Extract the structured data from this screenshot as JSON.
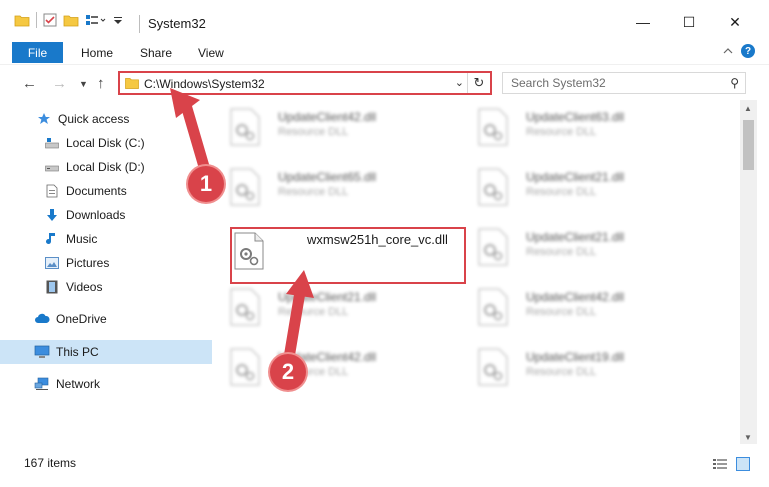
{
  "window": {
    "title": "System32",
    "controls": {
      "minimize": "—",
      "maximize": "☐",
      "close": "✕"
    }
  },
  "ribbon": {
    "file_tab": "File",
    "tabs": [
      "Home",
      "Share",
      "View"
    ],
    "help": "?"
  },
  "address": {
    "path": "C:\\Windows\\System32",
    "search_placeholder": "Search System32"
  },
  "sidebar": {
    "items": [
      {
        "label": "Quick access",
        "icon": "star-icon"
      },
      {
        "label": "Local Disk (C:)",
        "icon": "drive-icon"
      },
      {
        "label": "Local Disk (D:)",
        "icon": "drive-icon"
      },
      {
        "label": "Documents",
        "icon": "documents-icon"
      },
      {
        "label": "Downloads",
        "icon": "download-icon"
      },
      {
        "label": "Music",
        "icon": "music-icon"
      },
      {
        "label": "Pictures",
        "icon": "pictures-icon"
      },
      {
        "label": "Videos",
        "icon": "video-icon"
      },
      {
        "label": "OneDrive",
        "icon": "cloud-icon"
      },
      {
        "label": "This PC",
        "icon": "computer-icon"
      },
      {
        "label": "Network",
        "icon": "network-icon"
      }
    ]
  },
  "files": [
    {
      "name": "UpdateClient42.dll",
      "type": "Resource DLL"
    },
    {
      "name": "UpdateClient63.dll",
      "type": "Resource DLL"
    },
    {
      "name": "UpdateClient65.dll",
      "type": "Resource DLL"
    },
    {
      "name": "UpdateClient21.dll",
      "type": "Resource DLL"
    },
    {
      "name": "wxmsw251h_core_vc.dll",
      "type": ""
    },
    {
      "name": "UpdateClient21.dll",
      "type": "Resource DLL"
    },
    {
      "name": "UpdateClient21.dll",
      "type": "Resource DLL"
    },
    {
      "name": "UpdateClient42.dll",
      "type": "Resource DLL"
    },
    {
      "name": "UpdateClient42.dll",
      "type": "Resource DLL"
    },
    {
      "name": "UpdateClient19.dll",
      "type": "Resource DLL"
    }
  ],
  "status": {
    "count": "167 items"
  },
  "annotations": {
    "step1": "1",
    "step2": "2"
  },
  "colors": {
    "accent": "#1979ca",
    "highlight": "#d9434a",
    "selected": "#cce4f7"
  }
}
